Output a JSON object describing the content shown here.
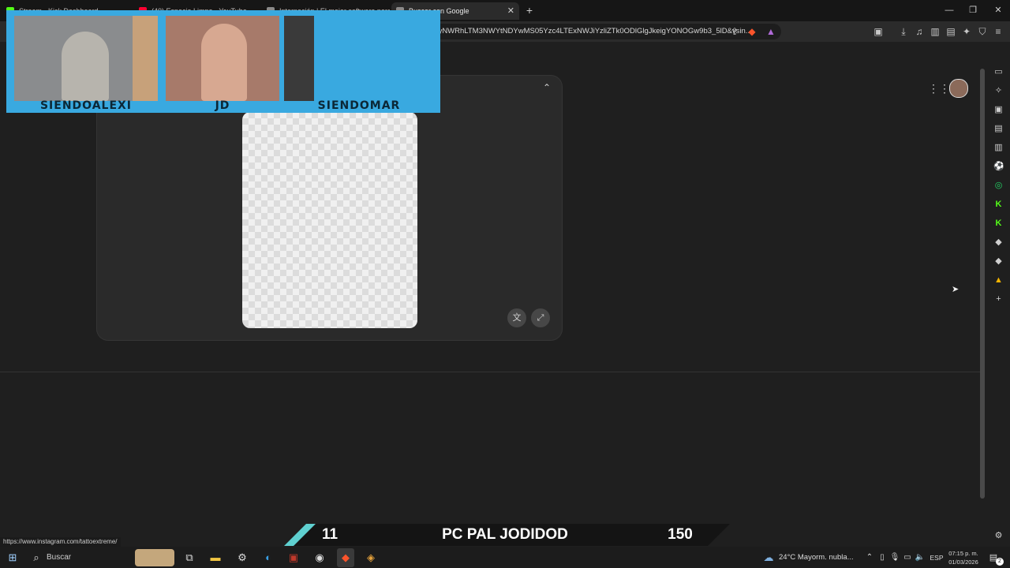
{
  "tabs": [
    {
      "title": "Stream - Kick Dashboard",
      "color": "#53fc18"
    },
    {
      "title": "(40) Espacio Limpo - YouTube",
      "color": "#ff0033"
    },
    {
      "title": "Internación | El mejor software para...",
      "color": "#8a8a8a"
    },
    {
      "title": "Buscar con Google",
      "color": "#8a8a8a"
    }
  ],
  "new_tab_symbol": "+",
  "url": "=CMiSiZX56Zz9ShACGAEiJDkyMzQyNWRhLTM3NWYtNDYwMS05Yzc4LTExNWJiYzliZTk0ODlGlgJkeigYONOGw9b3_5lD&vsin...",
  "webcams": [
    {
      "name": "SIENDOALEXI",
      "bg": "#8a8c8e"
    },
    {
      "name": "JD",
      "bg": "#a77a6a"
    },
    {
      "name": "SIENDOMAR",
      "bg": "#3a3a3a"
    }
  ],
  "status_url": "https://www.instagram.com/tattoextreme/",
  "banner": {
    "left": "11",
    "title": "PC PAL JODIDOD",
    "right": "150"
  },
  "taskbar": {
    "search_placeholder": "Buscar",
    "weather": "24°C  Mayorm. nubla...",
    "language": "ESP",
    "time": "07:15 p. m.",
    "date": "01/03/2026",
    "notification_count": "2"
  }
}
